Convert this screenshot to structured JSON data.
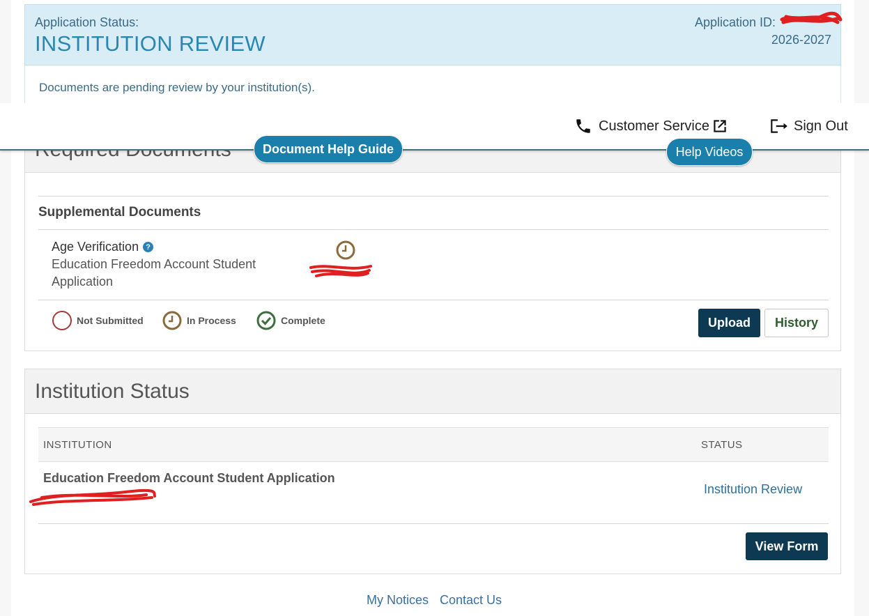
{
  "application": {
    "status_label": "Application Status:",
    "status_value": "INSTITUTION REVIEW",
    "id_label": "Application ID:",
    "year": "2026-2027",
    "pending_message": "Documents are pending review by your institution(s)."
  },
  "topbar": {
    "customer_service": "Customer Service",
    "sign_out": "Sign Out",
    "help_videos": "Help Videos",
    "document_help_guide": "Document Help Guide"
  },
  "required_documents": {
    "title": "Required Documents",
    "section_title": "Supplemental Documents",
    "document": {
      "name": "Age Verification",
      "description": "Education Freedom Account Student Application",
      "status_icon": "clock-icon"
    },
    "legend": {
      "not_submitted": "Not Submitted",
      "in_process": "In Process",
      "complete": "Complete"
    },
    "buttons": {
      "upload": "Upload",
      "history": "History"
    }
  },
  "institution_status": {
    "title": "Institution Status",
    "columns": {
      "institution": "INSTITUTION",
      "status": "STATUS"
    },
    "rows": [
      {
        "institution": "Education Freedom Account Student Application",
        "status": "Institution Review"
      }
    ],
    "view_form": "View Form"
  },
  "footer": {
    "my_notices": "My Notices",
    "contact_us": "Contact Us"
  },
  "colors": {
    "banner_bg": "#d9edf7",
    "accent_blue": "#1a7fab",
    "dark_button": "#0d3a52",
    "not_submitted": "#a23b3b",
    "in_process": "#8a6a3a",
    "complete": "#3e6e3e"
  }
}
